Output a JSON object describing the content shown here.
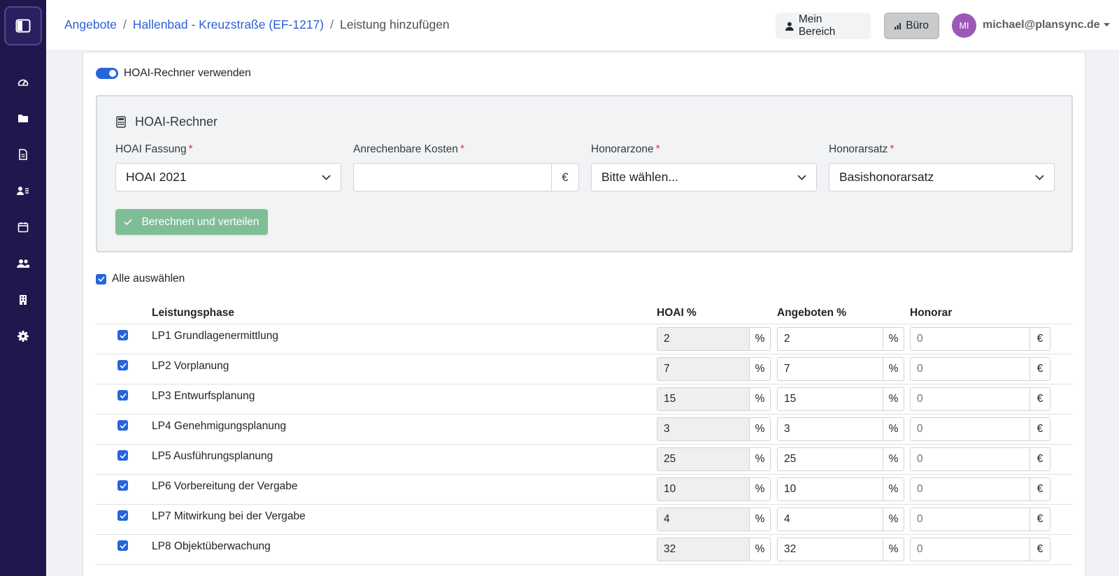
{
  "breadcrumb": {
    "items": [
      "Angebote",
      "Hallenbad - Kreuzstraße (EF-1217)"
    ],
    "separator": "/",
    "current": "Leistung hinzufügen"
  },
  "header": {
    "mein_bereich": "Mein Bereich",
    "buero": "Büro",
    "avatar_initials": "MI",
    "user_email": "michael@plansync.de"
  },
  "sidebar": {
    "icons": [
      "dashboard-icon",
      "folder-icon",
      "document-icon",
      "contacts-icon",
      "calendar-icon",
      "users-icon",
      "building-icon",
      "settings-icon"
    ]
  },
  "hoai_toggle": {
    "label": "HOAI-Rechner verwenden",
    "on": true
  },
  "calculator": {
    "title": "HOAI-Rechner",
    "fassung": {
      "label": "HOAI Fassung",
      "value": "HOAI 2021"
    },
    "kosten": {
      "label": "Anrechenbare Kosten",
      "value": "",
      "unit": "€"
    },
    "zone": {
      "label": "Honorarzone",
      "value": "Bitte wählen..."
    },
    "satz": {
      "label": "Honorarsatz",
      "value": "Basishonorarsatz"
    },
    "required_marker": "*",
    "button": "Berechnen und verteilen"
  },
  "select_all": {
    "label": "Alle auswählen",
    "checked": true
  },
  "table": {
    "headers": [
      "Leistungsphase",
      "HOAI %",
      "Angeboten %",
      "Honorar"
    ],
    "percent_unit": "%",
    "currency_unit": "€",
    "rows": [
      {
        "name": "LP1 Grundlagenermittlung",
        "hoai": "2",
        "angeboten": "2",
        "honorar": "0"
      },
      {
        "name": "LP2 Vorplanung",
        "hoai": "7",
        "angeboten": "7",
        "honorar": "0"
      },
      {
        "name": "LP3 Entwurfsplanung",
        "hoai": "15",
        "angeboten": "15",
        "honorar": "0"
      },
      {
        "name": "LP4 Genehmigungsplanung",
        "hoai": "3",
        "angeboten": "3",
        "honorar": "0"
      },
      {
        "name": "LP5 Ausführungsplanung",
        "hoai": "25",
        "angeboten": "25",
        "honorar": "0"
      },
      {
        "name": "LP6 Vorbereitung der Vergabe",
        "hoai": "10",
        "angeboten": "10",
        "honorar": "0"
      },
      {
        "name": "LP7 Mitwirkung bei der Vergabe",
        "hoai": "4",
        "angeboten": "4",
        "honorar": "0"
      },
      {
        "name": "LP8 Objektüberwachung",
        "hoai": "32",
        "angeboten": "32",
        "honorar": "0"
      }
    ]
  },
  "colors": {
    "sidebar": "#21174d",
    "primary": "#2565dd",
    "success": "#7fbd97",
    "avatar": "#9b59b6",
    "link": "#2d5fd3"
  }
}
